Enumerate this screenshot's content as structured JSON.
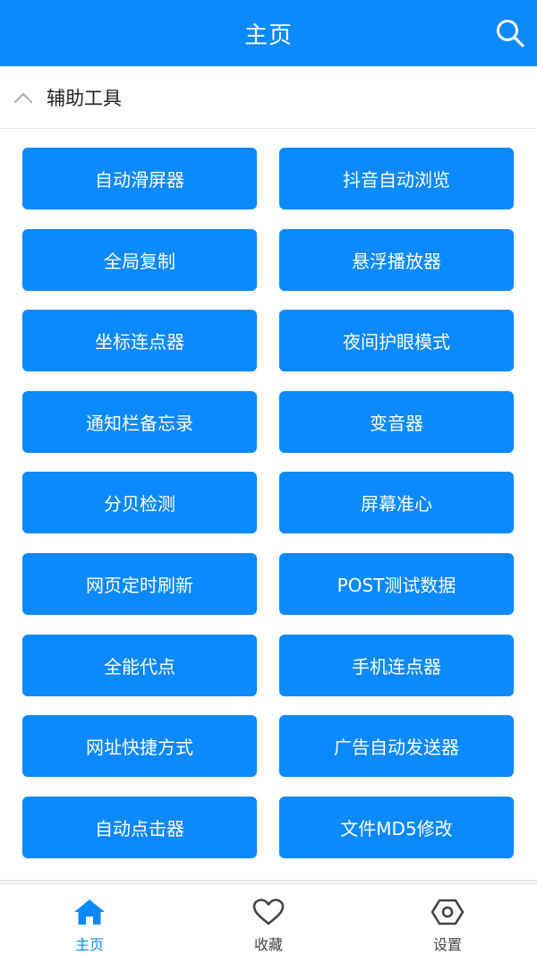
{
  "app_bar": {
    "title": "主页",
    "search_icon": "search-icon"
  },
  "section": {
    "title": "辅助工具",
    "collapse_icon": "chevron-up-icon"
  },
  "tools": [
    {
      "label": "自动滑屏器"
    },
    {
      "label": "抖音自动浏览"
    },
    {
      "label": "全局复制"
    },
    {
      "label": "悬浮播放器"
    },
    {
      "label": "坐标连点器"
    },
    {
      "label": "夜间护眼模式"
    },
    {
      "label": "通知栏备忘录"
    },
    {
      "label": "变音器"
    },
    {
      "label": "分贝检测"
    },
    {
      "label": "屏幕准心"
    },
    {
      "label": "网页定时刷新"
    },
    {
      "label": "POST测试数据"
    },
    {
      "label": "全能代点"
    },
    {
      "label": "手机连点器"
    },
    {
      "label": "网址快捷方式"
    },
    {
      "label": "广告自动发送器"
    },
    {
      "label": "自动点击器"
    },
    {
      "label": "文件MD5修改"
    }
  ],
  "bottom_nav": {
    "items": [
      {
        "label": "主页",
        "icon": "home-icon",
        "active": true
      },
      {
        "label": "收藏",
        "icon": "heart-icon",
        "active": false
      },
      {
        "label": "设置",
        "icon": "settings-icon",
        "active": false
      }
    ]
  },
  "colors": {
    "accent": "#0b89ff",
    "text_dark": "#222222",
    "nav_inactive": "#444444",
    "background": "#ffffff"
  }
}
